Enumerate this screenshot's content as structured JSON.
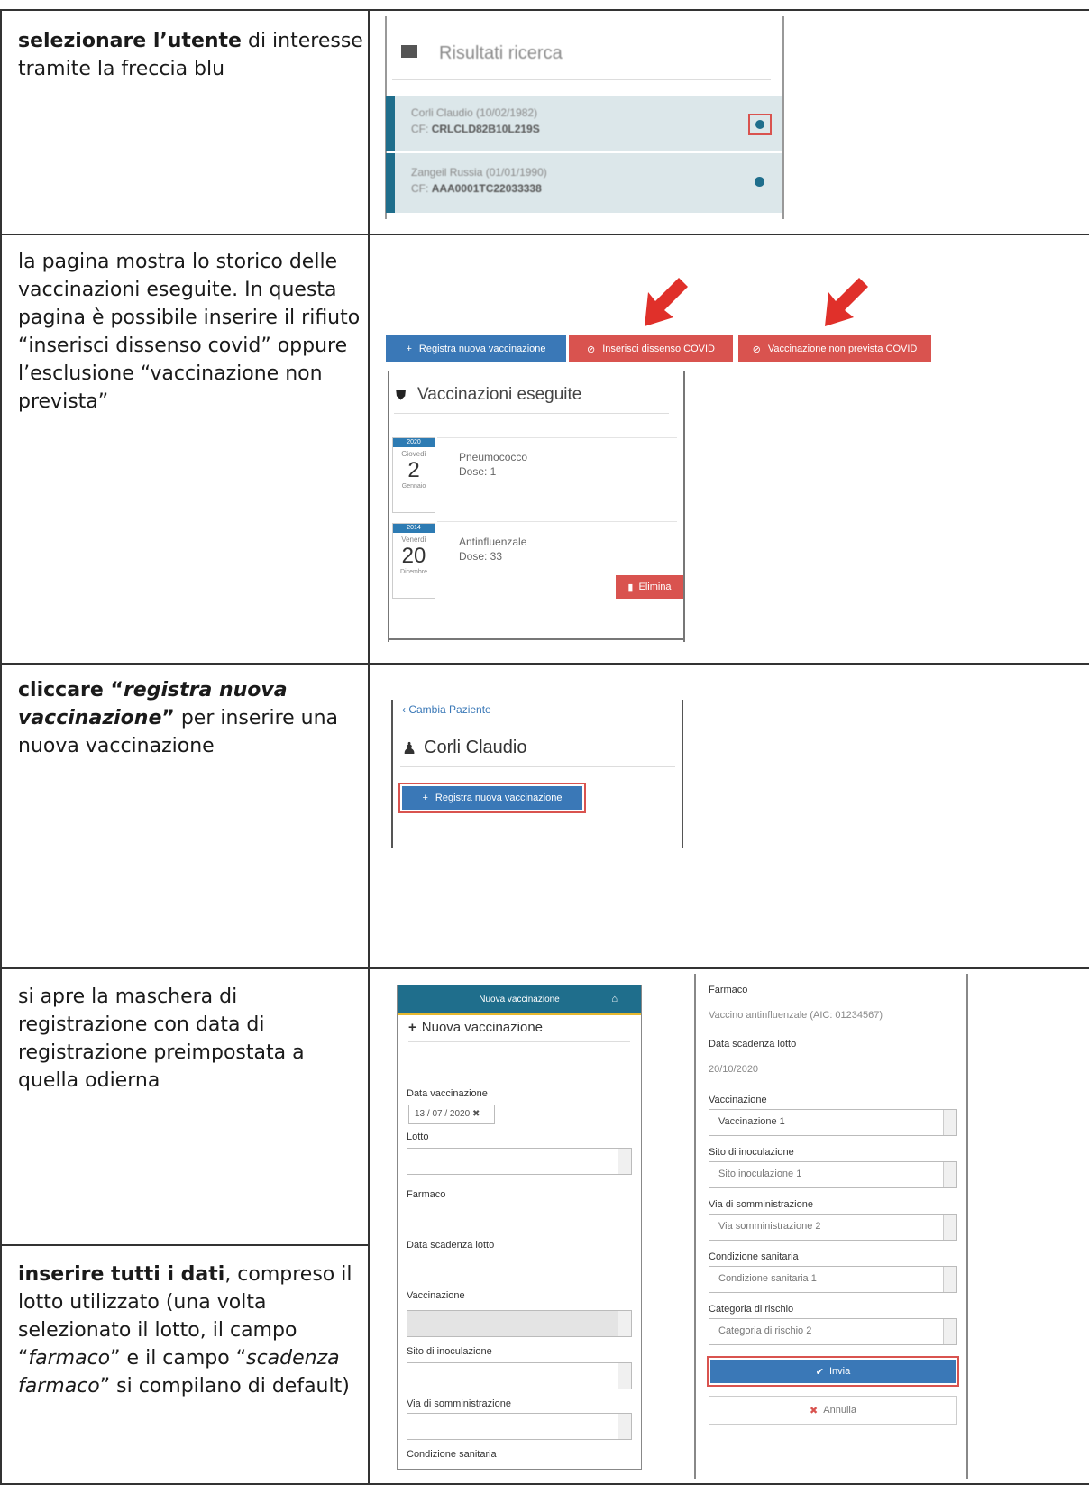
{
  "rows": [
    {
      "segments": [
        {
          "text": "selezionare l’utente",
          "bold": true
        },
        {
          "text": " di interesse tramite la freccia blu"
        }
      ]
    },
    {
      "segments": [
        {
          "text": "la pagina mostra lo storico delle vaccinazioni eseguite. In questa pagina è possibile inserire il rifiuto “inserisci dissenso covid” oppure l’esclusione “vaccinazione non prevista”"
        }
      ]
    },
    {
      "segments": [
        {
          "text": "cliccare “",
          "bold": true
        },
        {
          "text": "registra nuova vaccinazione",
          "bold": true,
          "italic": true
        },
        {
          "text": "”",
          "bold": true
        },
        {
          "text": " per inserire una nuova vaccinazione"
        }
      ]
    },
    {
      "segments": [
        {
          "text": "si apre la maschera di registrazione con data di registrazione preimpostata a quella odierna"
        }
      ]
    },
    {
      "segments": [
        {
          "text": "inserire tutti i dati",
          "bold": true
        },
        {
          "text": ", compreso il lotto utilizzato (una volta selezionato il lotto, il campo “"
        },
        {
          "text": "farmaco",
          "italic": true
        },
        {
          "text": "” e il campo “"
        },
        {
          "text": "scadenza farmaco",
          "italic": true
        },
        {
          "text": "” si compilano di default)"
        }
      ]
    }
  ],
  "shot1": {
    "title": "Risultati ricerca",
    "results": [
      {
        "name": "Corli Claudio (10/02/1982)",
        "cf_label": "CF:",
        "cf": "CRLCLD82B10L219S"
      },
      {
        "name": "Zangeil Russia (01/01/1990)",
        "cf_label": "CF:",
        "cf": "AAA0001TC22033338"
      }
    ]
  },
  "shot2": {
    "buttons": {
      "register": "Registra nuova vaccinazione",
      "dissent": "Inserisci dissenso COVID",
      "not_planned": "Vaccinazione non prevista COVID"
    },
    "section_title": "Vaccinazioni eseguite",
    "entries": [
      {
        "year": "2020",
        "weekday": "Giovedì",
        "day": "2",
        "month": "Gennaio",
        "vaccine": "Pneumococco",
        "dose": "Dose: 1"
      },
      {
        "year": "2014",
        "weekday": "Venerdì",
        "day": "20",
        "month": "Dicembre",
        "vaccine": "Antinfluenzale",
        "dose": "Dose: 33",
        "delete": "Elimina"
      }
    ]
  },
  "shot3": {
    "back_link": "Cambia Paziente",
    "patient_name": "Corli Claudio",
    "register_button": "Registra nuova vaccinazione"
  },
  "shot4": {
    "header": "Nuova vaccinazione",
    "title": "Nuova vaccinazione",
    "labels": {
      "data": "Data vaccinazione",
      "lotto": "Lotto",
      "farmaco": "Farmaco",
      "scadenza": "Data scadenza lotto",
      "vaccinazione": "Vaccinazione",
      "sito": "Sito di inoculazione",
      "via": "Via di somministrazione",
      "condizione": "Condizione sanitaria"
    },
    "date_value": "13 / 07 / 2020"
  },
  "shot5": {
    "farmaco_label": "Farmaco",
    "farmaco_value": "Vaccino antinfluenzale (AIC: 01234567)",
    "scadenza_label": "Data scadenza lotto",
    "scadenza_value": "20/10/2020",
    "vaccinazione_label": "Vaccinazione",
    "vaccinazione_value": "Vaccinazione 1",
    "sito_label": "Sito di inoculazione",
    "sito_value": "Sito inoculazione 1",
    "via_label": "Via di somministrazione",
    "via_value": "Via somministrazione 2",
    "condizione_label": "Condizione sanitaria",
    "condizione_value": "Condizione sanitaria 1",
    "categoria_label": "Categoria di rischio",
    "categoria_value": "Categoria di rischio 2",
    "submit": "Invia",
    "cancel": "Annulla"
  },
  "colors": {
    "blue": "#3a78b7",
    "red": "#d9534f",
    "teal": "#1f6e8c"
  }
}
